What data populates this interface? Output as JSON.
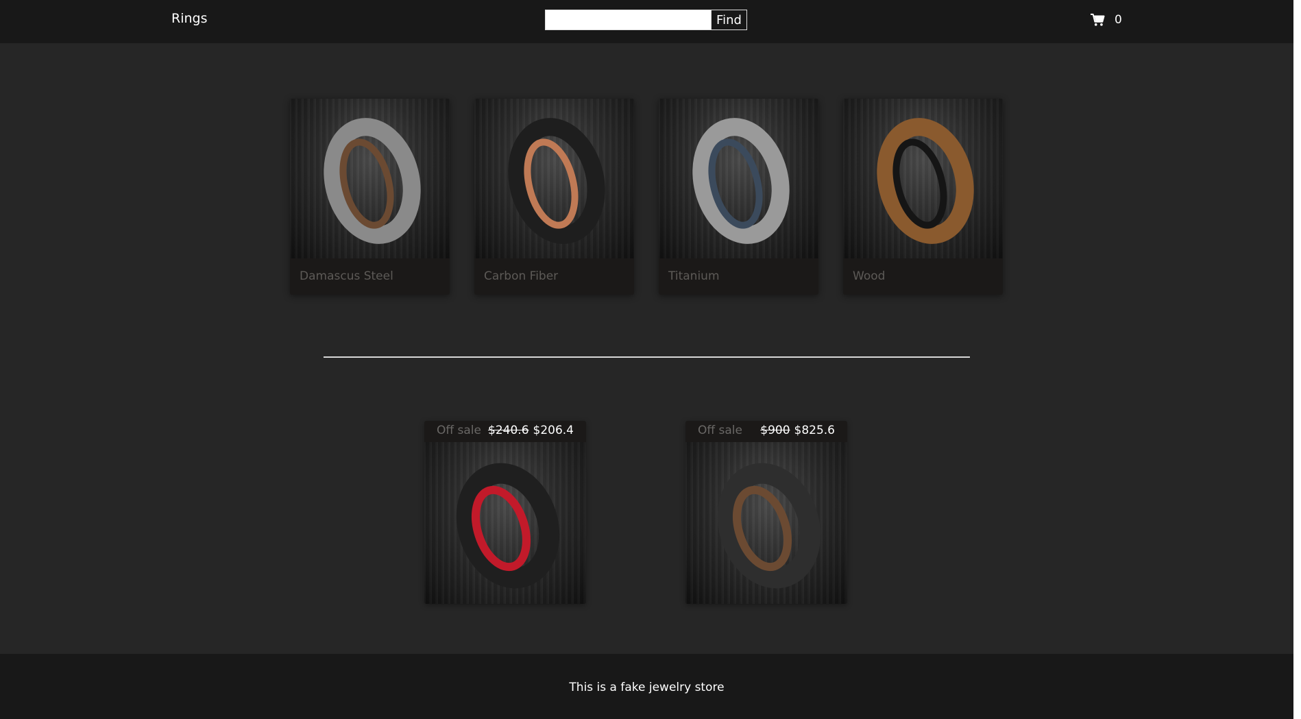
{
  "header": {
    "brand": "Rings",
    "search": {
      "value": "",
      "placeholder": "",
      "button_label": "Find"
    },
    "cart": {
      "icon": "cart-icon",
      "count": "0"
    }
  },
  "categories": [
    {
      "label": "Damascus Steel",
      "ring": {
        "outer": "#8a8a8a",
        "inner": "#6b4a32"
      }
    },
    {
      "label": "Carbon Fiber",
      "ring": {
        "outer": "#1e1e1e",
        "inner": "#c07a55"
      }
    },
    {
      "label": "Titanium",
      "ring": {
        "outer": "#9a9a9a",
        "inner": "#3b4a5c"
      }
    },
    {
      "label": "Wood",
      "ring": {
        "outer": "#8a5a2e",
        "inner": "#151515"
      }
    }
  ],
  "products": [
    {
      "sale_label": "Off sale",
      "old_price": "$240.6",
      "new_price": "$206.4",
      "ring": {
        "outer": "#1f1f1f",
        "inner": "#c21a2a"
      }
    },
    {
      "sale_label": "Off sale",
      "old_price": "$900",
      "new_price": "$825.6",
      "ring": {
        "outer": "#2e2e2e",
        "inner": "#6b4a32"
      }
    }
  ],
  "footer": {
    "text": "This is a fake jewelry store"
  },
  "colors": {
    "background": "#262626",
    "nav": "#181818",
    "card": "#1b1918",
    "muted_text": "#5d5a57"
  }
}
